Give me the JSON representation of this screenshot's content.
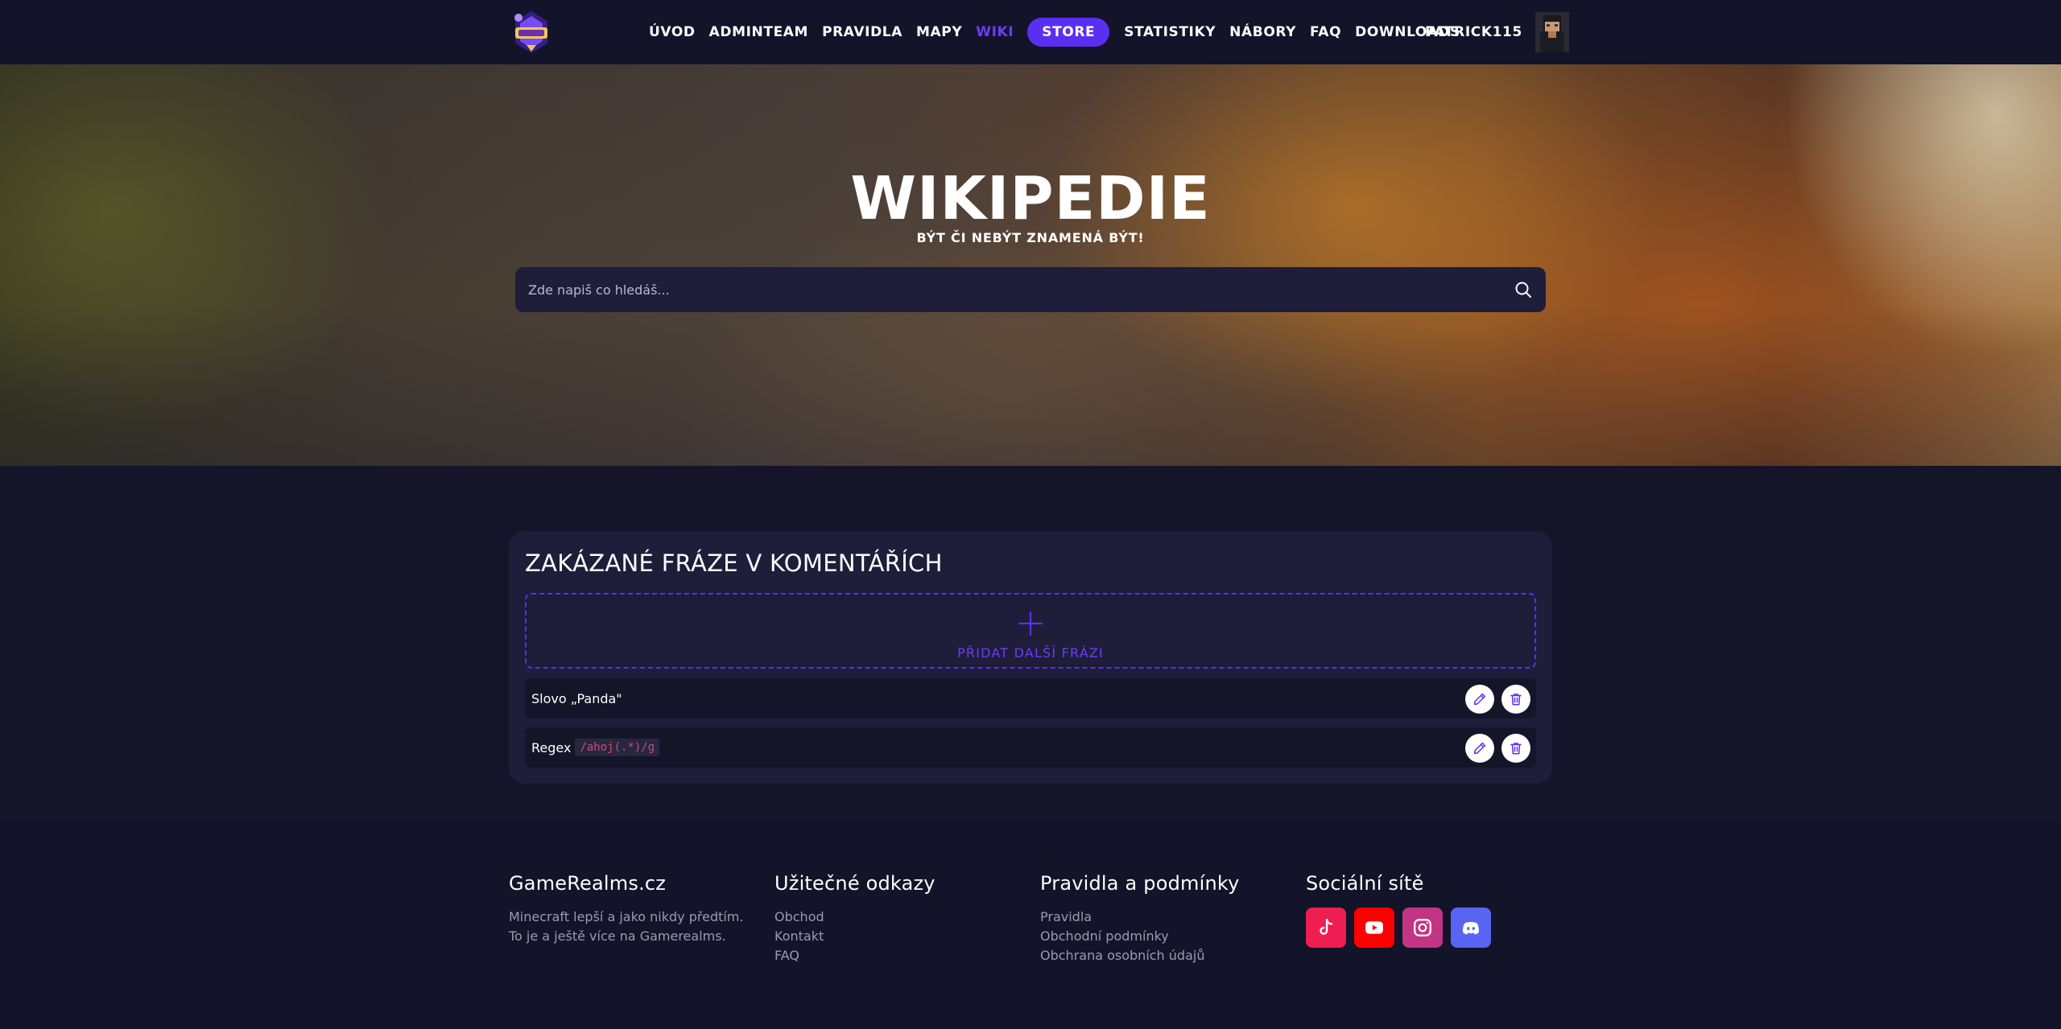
{
  "nav": {
    "links": [
      "ÚVOD",
      "ADMINTEAM",
      "PRAVIDLA",
      "MAPY",
      "WIKI"
    ],
    "store": "STORE",
    "links_after": [
      "STATISTIKY",
      "NÁBORY",
      "FAQ",
      "DOWNLOADS"
    ],
    "username": "PATRICK115"
  },
  "hero": {
    "title": "WIKIPEDIE",
    "subtitle": "BÝT ČI NEBÝT ZNAMENÁ BÝT!",
    "search_placeholder": "Zde napiš co hledáš..."
  },
  "card": {
    "title": "ZAKÁZANÉ FRÁZE V KOMENTÁŘÍCH",
    "add_label": "PŘIDAT DALŠÍ FRÁZI",
    "rows": [
      {
        "label": "Slovo „Panda\""
      },
      {
        "label": "Regex",
        "code": "/ahoj(.*)/g"
      }
    ]
  },
  "footer": {
    "col1": {
      "heading": "GameRealms.cz",
      "lines": [
        "Minecraft lepší a jako nikdy předtím.",
        "To je a ještě více na Gamerealms."
      ]
    },
    "col2": {
      "heading": "Užitečné odkazy",
      "links": [
        "Obchod",
        "Kontakt",
        "FAQ"
      ]
    },
    "col3": {
      "heading": "Pravidla a podmínky",
      "links": [
        "Pravidla",
        "Obchodní podmínky",
        "Obchrana osobních údajů"
      ]
    },
    "col4": {
      "heading": "Sociální sítě",
      "icons": [
        "tiktok-icon",
        "youtube-icon",
        "instagram-icon",
        "discord-icon"
      ]
    }
  },
  "colors": {
    "accent": "#5b2ff2",
    "accent_text": "#6d3df5",
    "page_bg": "#15152a",
    "card_bg": "#1e1e3a",
    "tiktok": "#ee1d52",
    "youtube": "#ff0000",
    "instagram": "#c13584",
    "discord": "#5865f2"
  }
}
